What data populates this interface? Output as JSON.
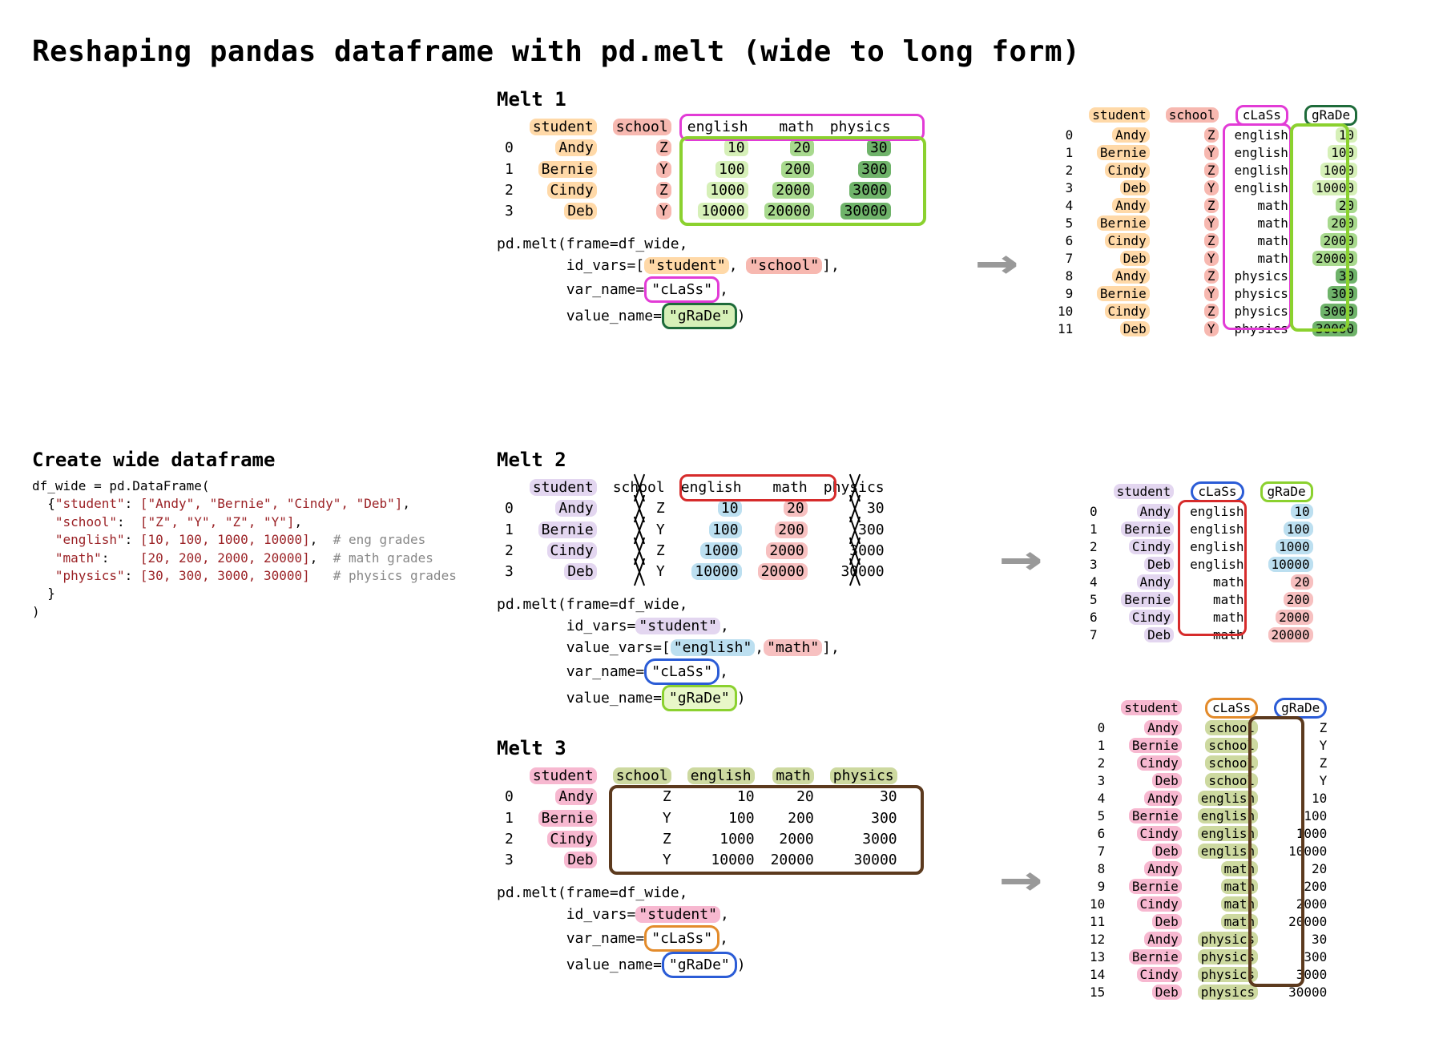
{
  "title": "Reshaping pandas dataframe with pd.melt (wide to long form)",
  "create": {
    "heading": "Create wide dataframe",
    "line1": "df_wide = pd.DataFrame(",
    "dict_open": "  {",
    "student_key": "\"student\"",
    "student_vals": "[\"Andy\", \"Bernie\", \"Cindy\", \"Deb\"]",
    "school_key": "\"school\"",
    "school_vals": "[\"Z\", \"Y\", \"Z\", \"Y\"]",
    "english_key": "\"english\"",
    "english_vals": "[10, 100, 1000, 10000]",
    "english_c": "# eng grades",
    "math_key": "\"math\"",
    "math_vals": "[20, 200, 2000, 20000]",
    "math_c": "# math grades",
    "physics_key": "\"physics\"",
    "physics_vals": "[30, 300, 3000, 30000]",
    "physics_c": "# physics grades",
    "dict_close": "  }",
    "close": ")"
  },
  "wide": {
    "cols": [
      "student",
      "school",
      "english",
      "math",
      "physics"
    ],
    "rows": [
      {
        "i": 0,
        "student": "Andy",
        "school": "Z",
        "english": 10,
        "math": 20,
        "physics": 30
      },
      {
        "i": 1,
        "student": "Bernie",
        "school": "Y",
        "english": 100,
        "math": 200,
        "physics": 300
      },
      {
        "i": 2,
        "student": "Cindy",
        "school": "Z",
        "english": 1000,
        "math": 2000,
        "physics": 3000
      },
      {
        "i": 3,
        "student": "Deb",
        "school": "Y",
        "english": 10000,
        "math": 20000,
        "physics": 30000
      }
    ]
  },
  "melt1": {
    "heading": "Melt 1",
    "code_l1": "pd.melt(frame=df_wide,",
    "code_l2_pre": "        id_vars=[",
    "code_l2_a": "\"student\"",
    "code_l2_sep": ", ",
    "code_l2_b": "\"school\"",
    "code_l2_post": "],",
    "code_l3_pre": "        var_name=",
    "code_l3_a": "\"cLaSs\"",
    "code_l3_post": ",",
    "code_l4_pre": "        value_name=",
    "code_l4_a": "\"gRaDe\"",
    "code_l4_post": ")",
    "out_cols": [
      "student",
      "school",
      "cLaSs",
      "gRaDe"
    ],
    "out_rows": [
      {
        "i": 0,
        "student": "Andy",
        "school": "Z",
        "class": "english",
        "grade": 10
      },
      {
        "i": 1,
        "student": "Bernie",
        "school": "Y",
        "class": "english",
        "grade": 100
      },
      {
        "i": 2,
        "student": "Cindy",
        "school": "Z",
        "class": "english",
        "grade": 1000
      },
      {
        "i": 3,
        "student": "Deb",
        "school": "Y",
        "class": "english",
        "grade": 10000
      },
      {
        "i": 4,
        "student": "Andy",
        "school": "Z",
        "class": "math",
        "grade": 20
      },
      {
        "i": 5,
        "student": "Bernie",
        "school": "Y",
        "class": "math",
        "grade": 200
      },
      {
        "i": 6,
        "student": "Cindy",
        "school": "Z",
        "class": "math",
        "grade": 2000
      },
      {
        "i": 7,
        "student": "Deb",
        "school": "Y",
        "class": "math",
        "grade": 20000
      },
      {
        "i": 8,
        "student": "Andy",
        "school": "Z",
        "class": "physics",
        "grade": 30
      },
      {
        "i": 9,
        "student": "Bernie",
        "school": "Y",
        "class": "physics",
        "grade": 300
      },
      {
        "i": 10,
        "student": "Cindy",
        "school": "Z",
        "class": "physics",
        "grade": 3000
      },
      {
        "i": 11,
        "student": "Deb",
        "school": "Y",
        "class": "physics",
        "grade": 30000
      }
    ]
  },
  "melt2": {
    "heading": "Melt 2",
    "code_l1": "pd.melt(frame=df_wide,",
    "code_l2_pre": "        id_vars=",
    "code_l2_a": "\"student\"",
    "code_l2_post": ",",
    "code_l3_pre": "        value_vars=[",
    "code_l3_a": "\"english\"",
    "code_l3_sep": ",",
    "code_l3_b": "\"math\"",
    "code_l3_post": "],",
    "code_l4_pre": "        var_name=",
    "code_l4_a": "\"cLaSs\"",
    "code_l4_post": ",",
    "code_l5_pre": "        value_name=",
    "code_l5_a": "\"gRaDe\"",
    "code_l5_post": ")",
    "out_cols": [
      "student",
      "cLaSs",
      "gRaDe"
    ],
    "out_rows": [
      {
        "i": 0,
        "student": "Andy",
        "class": "english",
        "grade": 10
      },
      {
        "i": 1,
        "student": "Bernie",
        "class": "english",
        "grade": 100
      },
      {
        "i": 2,
        "student": "Cindy",
        "class": "english",
        "grade": 1000
      },
      {
        "i": 3,
        "student": "Deb",
        "class": "english",
        "grade": 10000
      },
      {
        "i": 4,
        "student": "Andy",
        "class": "math",
        "grade": 20
      },
      {
        "i": 5,
        "student": "Bernie",
        "class": "math",
        "grade": 200
      },
      {
        "i": 6,
        "student": "Cindy",
        "class": "math",
        "grade": 2000
      },
      {
        "i": 7,
        "student": "Deb",
        "class": "math",
        "grade": 20000
      }
    ]
  },
  "melt3": {
    "heading": "Melt 3",
    "code_l1": "pd.melt(frame=df_wide,",
    "code_l2_pre": "        id_vars=",
    "code_l2_a": "\"student\"",
    "code_l2_post": ",",
    "code_l3_pre": "        var_name=",
    "code_l3_a": "\"cLaSs\"",
    "code_l3_post": ",",
    "code_l4_pre": "        value_name=",
    "code_l4_a": "\"gRaDe\"",
    "code_l4_post": ")",
    "out_cols": [
      "student",
      "cLaSs",
      "gRaDe"
    ],
    "out_rows": [
      {
        "i": 0,
        "student": "Andy",
        "class": "school",
        "grade": "Z"
      },
      {
        "i": 1,
        "student": "Bernie",
        "class": "school",
        "grade": "Y"
      },
      {
        "i": 2,
        "student": "Cindy",
        "class": "school",
        "grade": "Z"
      },
      {
        "i": 3,
        "student": "Deb",
        "class": "school",
        "grade": "Y"
      },
      {
        "i": 4,
        "student": "Andy",
        "class": "english",
        "grade": 10
      },
      {
        "i": 5,
        "student": "Bernie",
        "class": "english",
        "grade": 100
      },
      {
        "i": 6,
        "student": "Cindy",
        "class": "english",
        "grade": 1000
      },
      {
        "i": 7,
        "student": "Deb",
        "class": "english",
        "grade": 10000
      },
      {
        "i": 8,
        "student": "Andy",
        "class": "math",
        "grade": 20
      },
      {
        "i": 9,
        "student": "Bernie",
        "class": "math",
        "grade": 200
      },
      {
        "i": 10,
        "student": "Cindy",
        "class": "math",
        "grade": 2000
      },
      {
        "i": 11,
        "student": "Deb",
        "class": "math",
        "grade": 20000
      },
      {
        "i": 12,
        "student": "Andy",
        "class": "physics",
        "grade": 30
      },
      {
        "i": 13,
        "student": "Bernie",
        "class": "physics",
        "grade": 300
      },
      {
        "i": 14,
        "student": "Cindy",
        "class": "physics",
        "grade": 3000
      },
      {
        "i": 15,
        "student": "Deb",
        "class": "physics",
        "grade": 30000
      }
    ]
  }
}
